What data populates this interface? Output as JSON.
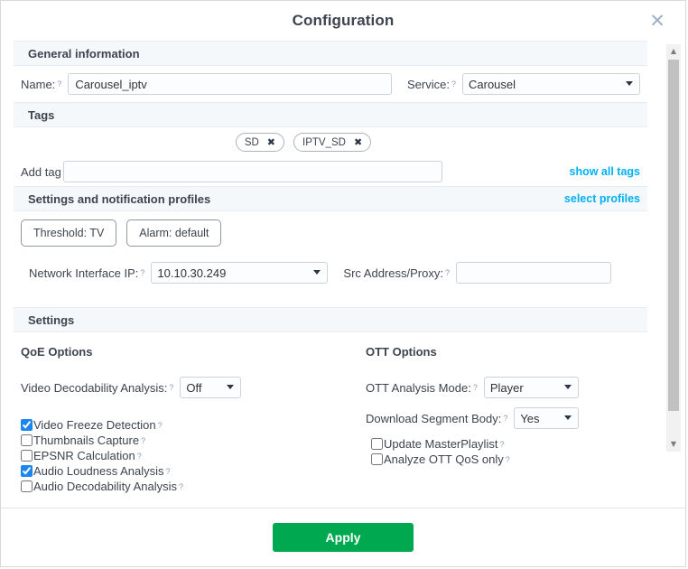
{
  "dialog": {
    "title": "Configuration",
    "close_icon": "close-icon",
    "help_marker": "?"
  },
  "sections": {
    "general": {
      "heading": "General information",
      "name_label": "Name:",
      "name_value": "Carousel_iptv",
      "service_label": "Service:",
      "service_value": "Carousel",
      "service_options": [
        "Carousel"
      ]
    },
    "tags": {
      "heading": "Tags",
      "chips": [
        {
          "label": "SD",
          "remove_icon": "✖"
        },
        {
          "label": "IPTV_SD",
          "remove_icon": "✖"
        }
      ],
      "add_tag_label": "Add tag",
      "add_tag_value": "",
      "add_tag_placeholder": "",
      "show_all_tags_link": "show all tags"
    },
    "profiles": {
      "heading": "Settings and notification profiles",
      "select_profiles_link": "select profiles",
      "buttons": [
        {
          "label": "Threshold: TV"
        },
        {
          "label": "Alarm: default"
        }
      ],
      "network_interface_label": "Network Interface IP:",
      "network_interface_value": "10.10.30.249",
      "network_interface_options": [
        "10.10.30.249"
      ],
      "src_address_label": "Src Address/Proxy:",
      "src_address_value": "",
      "src_address_placeholder": ""
    },
    "settings": {
      "heading": "Settings",
      "qoe": {
        "heading": "QoE Options",
        "video_decodability_label": "Video Decodability Analysis:",
        "video_decodability_value": "Off",
        "video_decodability_options": [
          "Off"
        ],
        "checkboxes": [
          {
            "label": "Video Freeze Detection",
            "checked": true
          },
          {
            "label": "Thumbnails Capture",
            "checked": false
          },
          {
            "label": "EPSNR Calculation",
            "checked": false
          },
          {
            "label": "Audio Loudness Analysis",
            "checked": true
          },
          {
            "label": "Audio Decodability Analysis",
            "checked": false
          }
        ]
      },
      "ott": {
        "heading": "OTT Options",
        "analysis_mode_label": "OTT Analysis Mode:",
        "analysis_mode_value": "Player",
        "analysis_mode_options": [
          "Player"
        ],
        "download_segment_label": "Download Segment Body:",
        "download_segment_value": "Yes",
        "download_segment_options": [
          "Yes"
        ],
        "checkboxes": [
          {
            "label": "Update MasterPlaylist",
            "checked": false
          },
          {
            "label": "Analyze OTT QoS only",
            "checked": false
          }
        ]
      }
    }
  },
  "footer": {
    "apply_label": "Apply"
  },
  "scrollbar": {
    "up_arrow": "▲",
    "down_arrow": "▼"
  },
  "colors": {
    "accent_link": "#00b0f0",
    "apply_green": "#00a94f",
    "checkbox_blue": "#1a86f0",
    "section_header_bg": "#f4f8fb"
  }
}
